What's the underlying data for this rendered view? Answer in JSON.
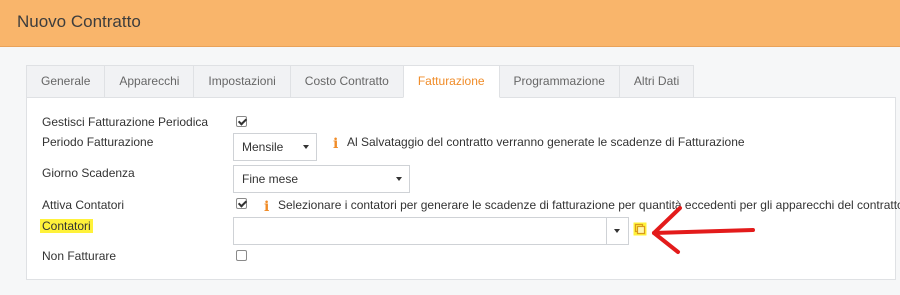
{
  "header": {
    "title": "Nuovo Contratto"
  },
  "tabs": [
    {
      "label": "Generale",
      "active": false
    },
    {
      "label": "Apparecchi",
      "active": false
    },
    {
      "label": "Impostazioni",
      "active": false
    },
    {
      "label": "Costo Contratto",
      "active": false
    },
    {
      "label": "Fatturazione",
      "active": true
    },
    {
      "label": "Programmazione",
      "active": false
    },
    {
      "label": "Altri Dati",
      "active": false
    }
  ],
  "form": {
    "gestisci": {
      "label": "Gestisci Fatturazione Periodica",
      "checked": true
    },
    "periodo": {
      "label": "Periodo Fatturazione",
      "value": "Mensile",
      "info": "Al Salvataggio del contratto verranno generate le scadenze di Fatturazione"
    },
    "giorno": {
      "label": "Giorno Scadenza",
      "value": "Fine mese"
    },
    "attiva": {
      "label": "Attiva Contatori",
      "checked": true,
      "info": "Selezionare i contatori per generare le scadenze di fatturazione per quantità eccedenti per gli apparecchi del contratto"
    },
    "contatori": {
      "label": "Contatori",
      "value": ""
    },
    "non_fatturare": {
      "label": "Non Fatturare",
      "checked": false
    }
  },
  "colors": {
    "header": "#f9b56b",
    "accent": "#f08c28",
    "highlight": "#fff23a",
    "arrow": "#e31b1b"
  },
  "icons": {
    "info": "info-icon",
    "copy": "copy-icon",
    "arrow": "red-arrow-annotation"
  }
}
